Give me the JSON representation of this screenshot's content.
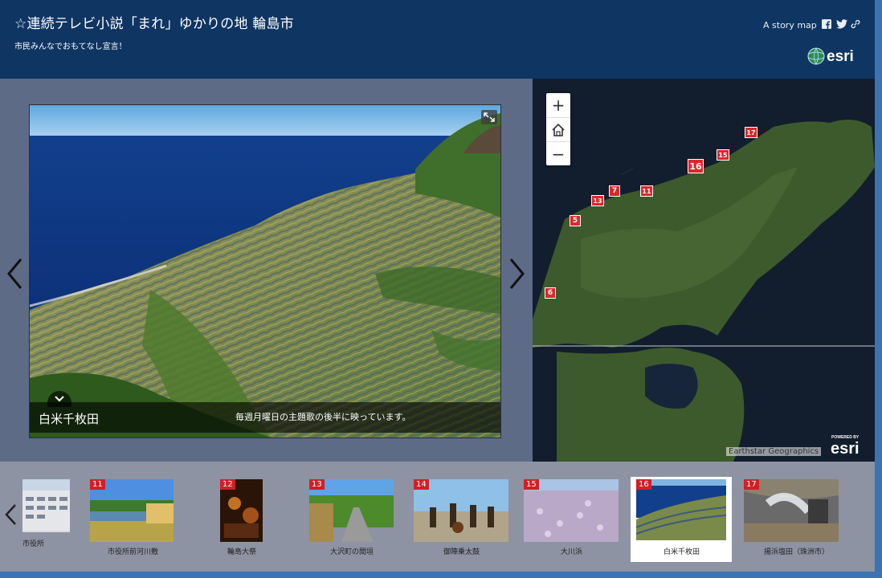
{
  "header": {
    "title": "☆連続テレビ小説「まれ」ゆかりの地  輪島市",
    "subtitle": "市民みんなでおもてなし宣言！",
    "story_map_label": "A story map",
    "icons": [
      "facebook-icon",
      "twitter-icon",
      "link-icon"
    ],
    "logo_text": "esri"
  },
  "media": {
    "caption_title": "白米千枚田",
    "caption_text": "毎週月曜日の主題歌の後半に映っています。"
  },
  "map": {
    "zoom_in": "+",
    "zoom_out": "−",
    "attribution": "Earthstar Geographics",
    "powered_by": "POWERED BY",
    "powered_logo": "esri",
    "markers": [
      "5",
      "6",
      "7",
      "11",
      "13",
      "15",
      "16",
      "17"
    ]
  },
  "carousel": {
    "items": [
      {
        "num": "",
        "label": "市役所"
      },
      {
        "num": "11",
        "label": "市役所前河川敷"
      },
      {
        "num": "12",
        "label": "輪島大祭"
      },
      {
        "num": "13",
        "label": "大沢町の間垣"
      },
      {
        "num": "14",
        "label": "御陣乗太鼓"
      },
      {
        "num": "15",
        "label": "大川浜"
      },
      {
        "num": "16",
        "label": "白米千枚田",
        "active": true
      },
      {
        "num": "17",
        "label": "揚浜塩田（珠洲市）"
      }
    ]
  },
  "colors": {
    "header_bg": "#0f3562",
    "marker_red": "#e0252b",
    "carousel_bg": "#8d93a2",
    "panel_bg": "#5d6b86"
  }
}
